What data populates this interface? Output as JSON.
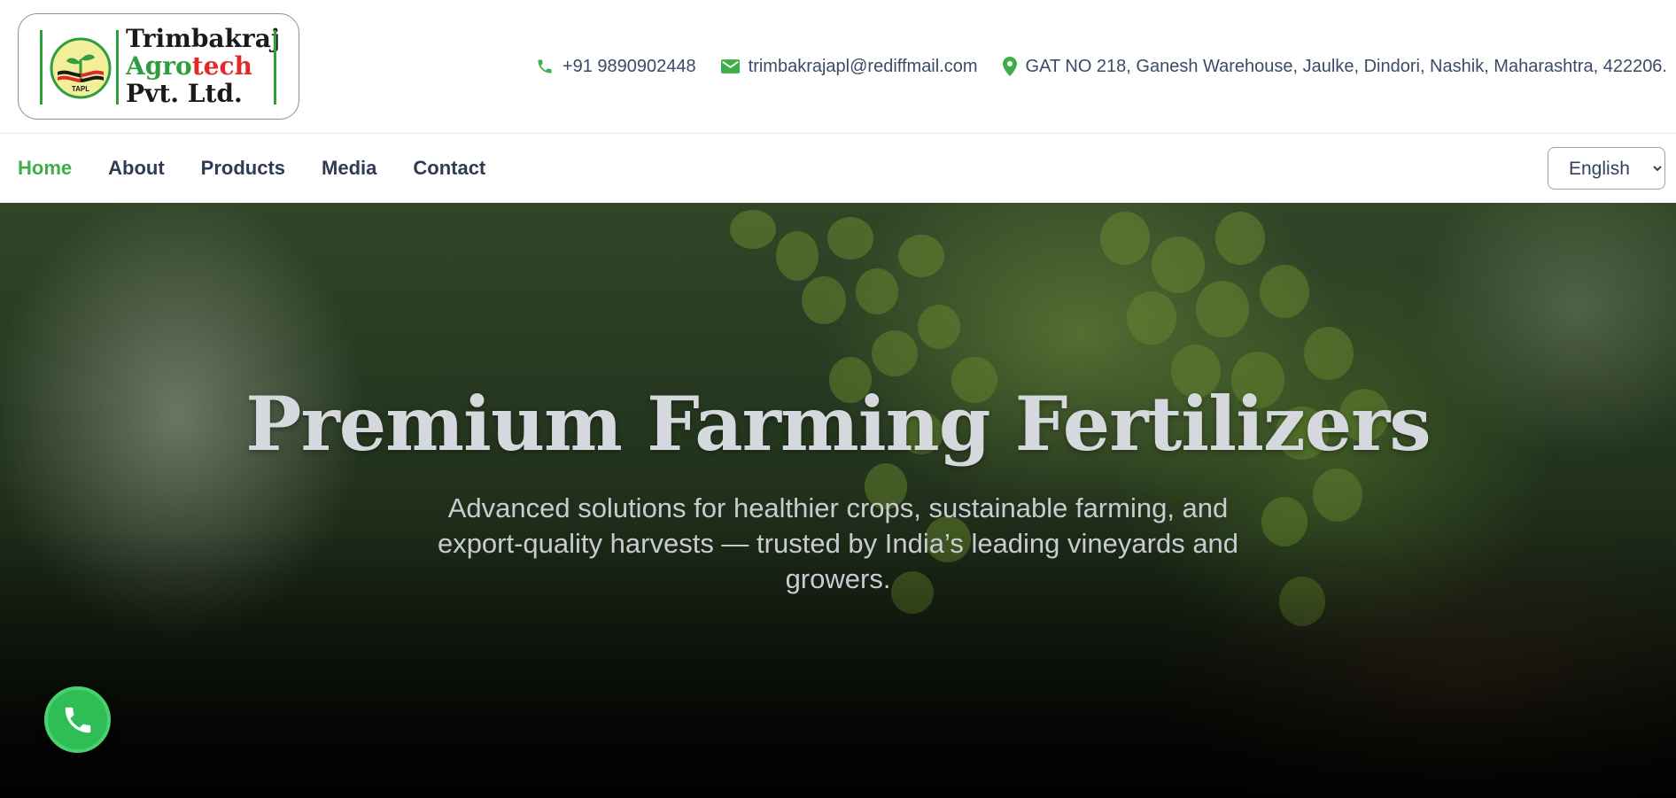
{
  "brand": {
    "line1": "Trimbakraj",
    "line2_a": "Agro",
    "line2_b": "tech",
    "line3": "Pvt. Ltd.",
    "emblem_text": "TAPL",
    "colors": {
      "green": "#2e9e3f",
      "red": "#e02a2a"
    }
  },
  "contact": {
    "phone": "+91 9890902448",
    "email": "trimbakrajapl@rediffmail.com",
    "address": "GAT NO 218, Ganesh Warehouse, Jaulke, Dindori, Nashik, Maharashtra, 422206.",
    "icons": [
      "phone-icon",
      "envelope-icon",
      "map-pin-icon"
    ]
  },
  "nav": {
    "items": [
      {
        "label": "Home",
        "active": true
      },
      {
        "label": "About",
        "active": false
      },
      {
        "label": "Products",
        "active": false
      },
      {
        "label": "Media",
        "active": false
      },
      {
        "label": "Contact",
        "active": false
      }
    ],
    "language": "English",
    "accent": "#3fae49"
  },
  "hero": {
    "title": "Premium Farming Fertilizers",
    "subtitle": "Advanced solutions for healthier crops, sustainable farming, and export-quality harvests — trusted by India’s leading vineyards and growers."
  },
  "fab": {
    "icon": "phone-icon",
    "color": "#2fbe55"
  }
}
